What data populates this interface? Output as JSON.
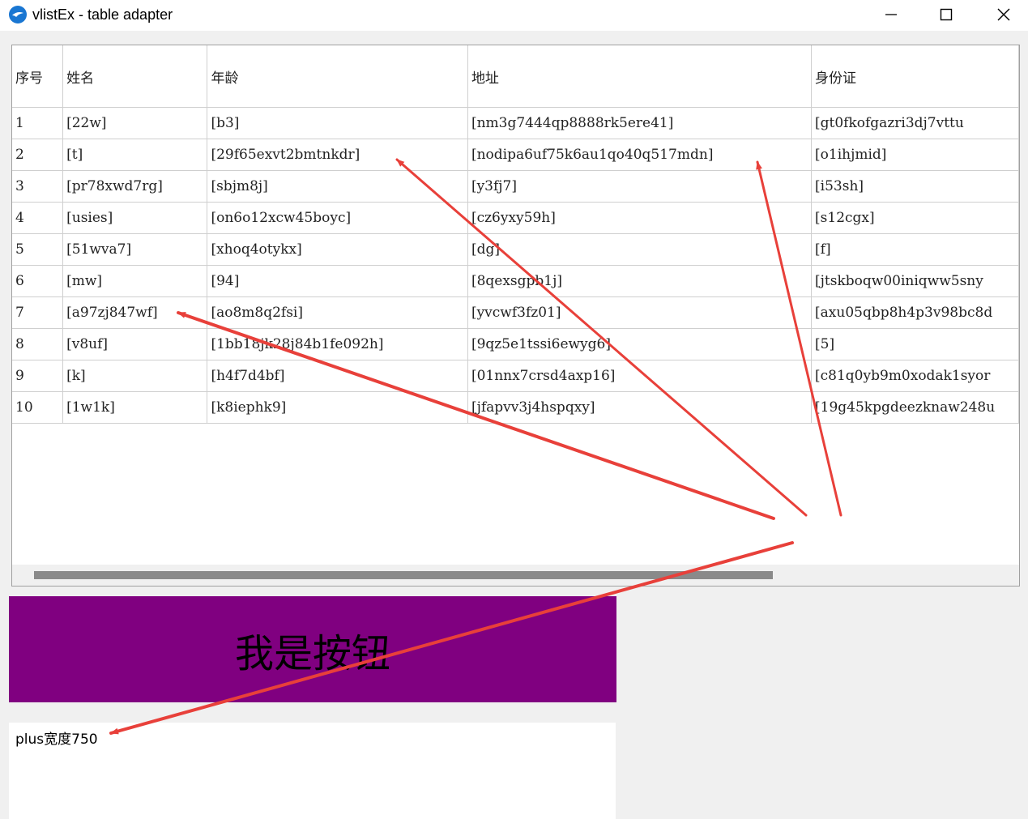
{
  "window": {
    "title": "vlistEx - table adapter"
  },
  "table": {
    "columns": [
      "序号",
      "姓名",
      "年龄",
      "地址",
      "身份证"
    ],
    "rows": [
      [
        "1",
        "[22w]",
        "[b3]",
        "[nm3g7444qp8888rk5ere41]",
        "[gt0fkofgazri3dj7vttu"
      ],
      [
        "2",
        "[t]",
        "[29f65exvt2bmtnkdr]",
        "[nodipa6uf75k6au1qo40q517mdn]",
        "[o1ihjmid]"
      ],
      [
        "3",
        "[pr78xwd7rg]",
        "[sbjm8j]",
        "[y3fj7]",
        "[i53sh]"
      ],
      [
        "4",
        "[usies]",
        "[on6o12xcw45boyc]",
        "[cz6yxy59h]",
        "[s12cgx]"
      ],
      [
        "5",
        "[51wva7]",
        "[xhoq4otykx]",
        "[dg]",
        "[f]"
      ],
      [
        "6",
        "[mw]",
        "[94]",
        "[8qexsgpb1j]",
        "[jtskboqw00iniqww5sny"
      ],
      [
        "7",
        "[a97zj847wf]",
        "[ao8m8q2fsi]",
        "[yvcwf3fz01]",
        "[axu05qbp8h4p3v98bc8d"
      ],
      [
        "8",
        "[v8uf]",
        "[1bb18jk28j84b1fe092h]",
        "[9qz5e1tssi6ewyg6]",
        "[5]"
      ],
      [
        "9",
        "[k]",
        "[h4f7d4bf]",
        "[01nnx7crsd4axp16]",
        "[c81q0yb9m0xodak1syor"
      ],
      [
        "10",
        "[1w1k]",
        "[k8iephk9]",
        "[jfapvv3j4hspqxy]",
        "[19g45kpgdeezknaw248u"
      ]
    ]
  },
  "button": {
    "label": "我是按钮",
    "color": "#800080"
  },
  "textbox": {
    "value": "plus宽度750"
  },
  "annotation_color": "#e8403a"
}
